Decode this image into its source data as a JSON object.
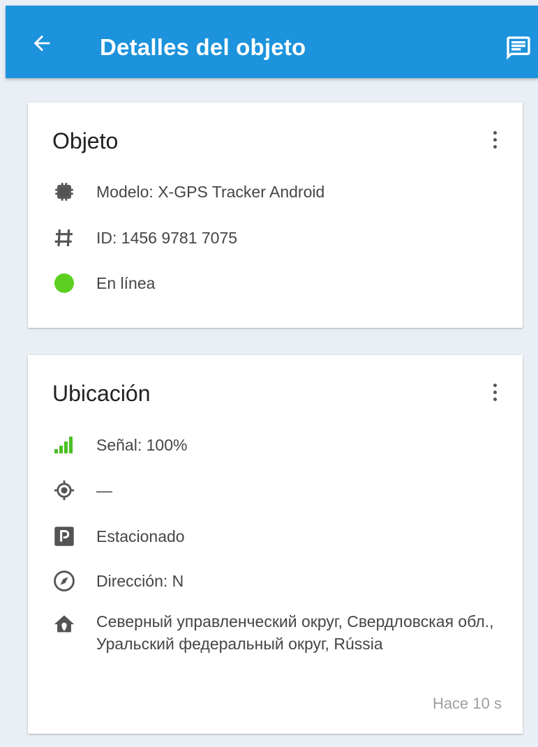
{
  "appbar": {
    "title": "Detalles del objeto",
    "back_icon": "arrow-back-icon",
    "message_icon": "message-icon",
    "color": "#1c93dc"
  },
  "object_card": {
    "title": "Objeto",
    "model": "Modelo: X-GPS Tracker Android",
    "id": "ID: 1456 9781 7075",
    "status": "En línea",
    "status_color": "#5bcf1f"
  },
  "location_card": {
    "title": "Ubicación",
    "signal": "Señal: 100%",
    "signal_color": "#4bbf23",
    "gps": "—",
    "parking": "Estacionado",
    "direction": "Dirección: N",
    "address": "Северный управленческий округ, Свердловская обл., Уральский федеральный округ, Rússia",
    "timestamp": "Hace 10 s"
  }
}
